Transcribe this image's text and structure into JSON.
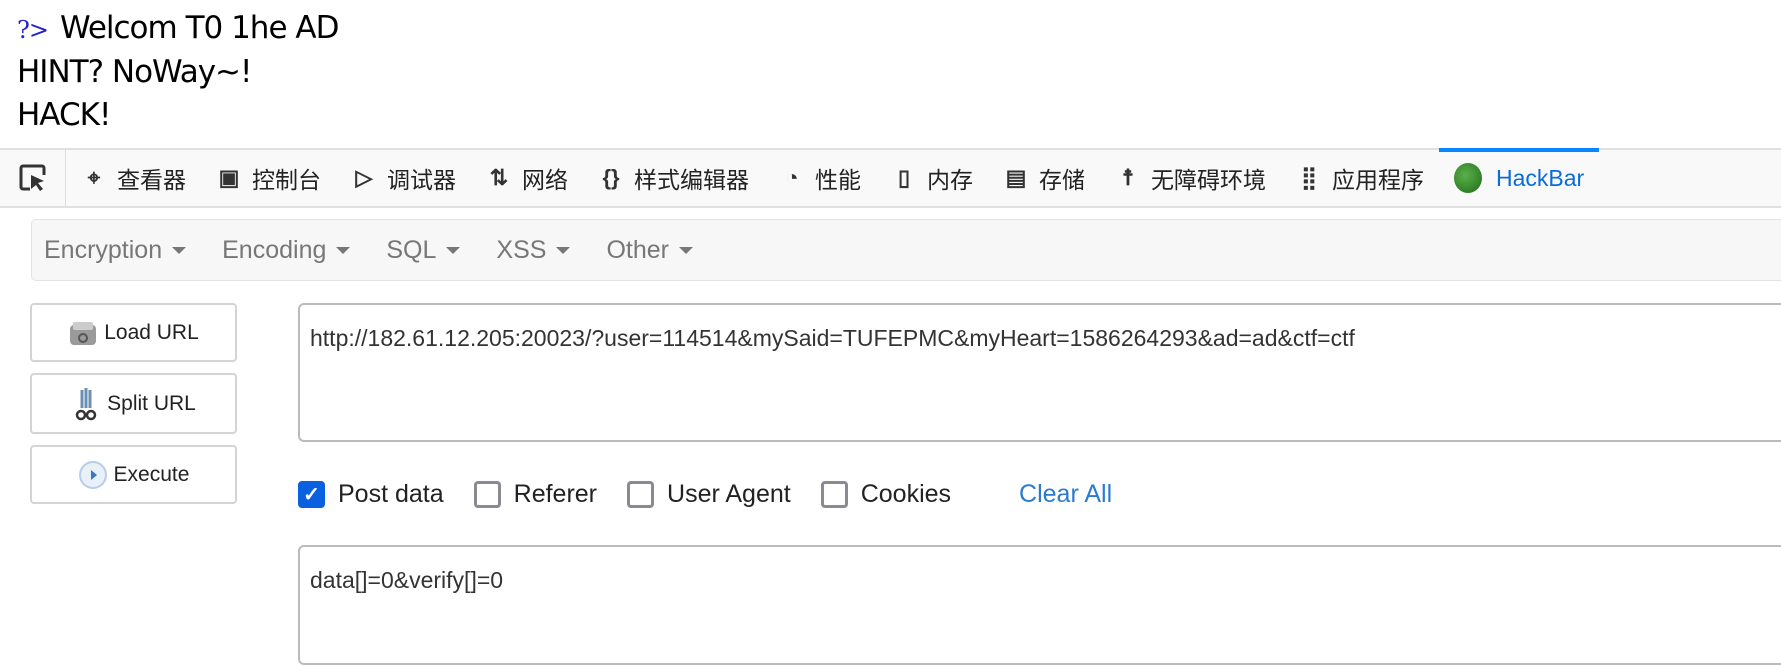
{
  "page": {
    "prefix": "?>",
    "line1": "Welcom T0 1he AD",
    "line2": "HINT? NoWay~!",
    "line3": "HACK!"
  },
  "devtools": {
    "tabs": [
      {
        "label": "查看器",
        "icon": "inspector-icon"
      },
      {
        "label": "控制台",
        "icon": "console-icon"
      },
      {
        "label": "调试器",
        "icon": "debugger-icon"
      },
      {
        "label": "网络",
        "icon": "network-icon"
      },
      {
        "label": "样式编辑器",
        "icon": "style-editor-icon"
      },
      {
        "label": "性能",
        "icon": "performance-icon"
      },
      {
        "label": "内存",
        "icon": "memory-icon"
      },
      {
        "label": "存储",
        "icon": "storage-icon"
      },
      {
        "label": "无障碍环境",
        "icon": "accessibility-icon"
      },
      {
        "label": "应用程序",
        "icon": "application-icon"
      },
      {
        "label": "HackBar",
        "icon": "hackbar-icon"
      }
    ],
    "active": "HackBar",
    "accent": "#0a84ff"
  },
  "hackbar": {
    "menus": [
      "Encryption",
      "Encoding",
      "SQL",
      "XSS",
      "Other"
    ],
    "buttons": {
      "load": "Load URL",
      "split": "Split URL",
      "execute": "Execute"
    },
    "url": "http://182.61.12.205:20023/?user=114514&mySaid=TUFEPMC&myHeart=1586264293&ad=ad&ctf=ctf",
    "options": [
      {
        "label": "Post data",
        "checked": true
      },
      {
        "label": "Referer",
        "checked": false
      },
      {
        "label": "User Agent",
        "checked": false
      },
      {
        "label": "Cookies",
        "checked": false
      }
    ],
    "clear_all": "Clear All",
    "post_data": "data[]=0&verify[]=0"
  }
}
